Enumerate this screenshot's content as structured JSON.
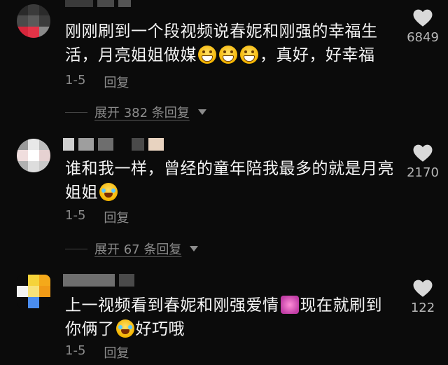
{
  "comments": [
    {
      "text_before": "刚刚刷到一个段视频说春妮和刚强的幸福生活，月亮姐姐做媒",
      "emojis": [
        "grin-emoji",
        "grin-emoji",
        "grin-emoji"
      ],
      "text_after": "，真好，好幸福",
      "date": "1-5",
      "reply_label": "回复",
      "likes": "6849",
      "expand_label": "展开 382 条回复"
    },
    {
      "text_before": "谁和我一样，曾经的童年陪我最多的就是月亮姐姐",
      "emojis": [
        "laugh-cry-emoji"
      ],
      "text_after": "",
      "date": "1-5",
      "reply_label": "回复",
      "likes": "2170",
      "expand_label": "展开 67 条回复"
    },
    {
      "text_before": "上一视频看到春妮和刚强爱情",
      "emojis": [
        "couple-heart-emoji"
      ],
      "text_middle": "现在就刷到你俩了",
      "emojis2": [
        "laugh-cry-emoji"
      ],
      "text_after": "好巧哦",
      "date": "1-5",
      "reply_label": "回复",
      "likes": "122"
    }
  ],
  "icons": {
    "like": "heart-icon",
    "expand_caret": "caret-down-icon"
  },
  "colors": {
    "background": "#0b0b0b",
    "muted_text": "#8c8c8c",
    "like_icon": "#d9d9d9"
  }
}
